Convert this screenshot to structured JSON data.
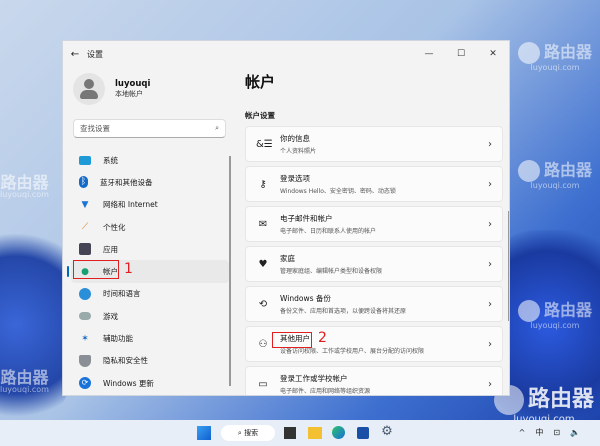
{
  "watermark": {
    "brand": "路由器",
    "domain": "luyouqi.com"
  },
  "window": {
    "title": "设置",
    "minimize": "—",
    "maximize": "☐",
    "close": "✕",
    "back": "←"
  },
  "profile": {
    "name": "luyouqi",
    "type": "本地帐户"
  },
  "search": {
    "placeholder": "查找设置",
    "icon": "⌕"
  },
  "nav": [
    {
      "label": "系统",
      "icon": "system-icon"
    },
    {
      "label": "蓝牙和其他设备",
      "icon": "bluetooth-icon"
    },
    {
      "label": "网络和 Internet",
      "icon": "wifi-icon"
    },
    {
      "label": "个性化",
      "icon": "brush-icon"
    },
    {
      "label": "应用",
      "icon": "apps-icon"
    },
    {
      "label": "帐户",
      "icon": "account-icon",
      "selected": true
    },
    {
      "label": "时间和语言",
      "icon": "clock-globe-icon"
    },
    {
      "label": "游戏",
      "icon": "gamepad-icon"
    },
    {
      "label": "辅助功能",
      "icon": "accessibility-icon"
    },
    {
      "label": "隐私和安全性",
      "icon": "shield-icon"
    },
    {
      "label": "Windows 更新",
      "icon": "update-icon"
    }
  ],
  "annotations": {
    "one": "1",
    "two": "2"
  },
  "main": {
    "title": "帐户",
    "section": "帐户设置",
    "cards": [
      {
        "title": "你的信息",
        "sub": "个人资料照片",
        "icon": "&☰"
      },
      {
        "title": "登录选项",
        "sub": "Windows Hello、安全密钥、密码、动态锁",
        "icon": "⚷"
      },
      {
        "title": "电子邮件和帐户",
        "sub": "电子邮件、日历和联系人使用的帐户",
        "icon": "✉"
      },
      {
        "title": "家庭",
        "sub": "管理家庭组、编辑帐户类型和设备权限",
        "icon": "♥"
      },
      {
        "title": "Windows 备份",
        "sub": "备份文件、应用和首选项，以便跨设备将其还原",
        "icon": "⟲"
      },
      {
        "title": "其他用户",
        "sub": "设备访问权限、工作或学校用户、展台分配的访问权限",
        "icon": "⚇"
      },
      {
        "title": "登录工作或学校帐户",
        "sub": "电子邮件、应用和网络等组织资源",
        "icon": "▭"
      }
    ],
    "chevron": "›"
  },
  "taskbar": {
    "search": "搜索",
    "tray_caret": "^",
    "ime": "中",
    "network": "⊡",
    "volume": "🔈"
  }
}
